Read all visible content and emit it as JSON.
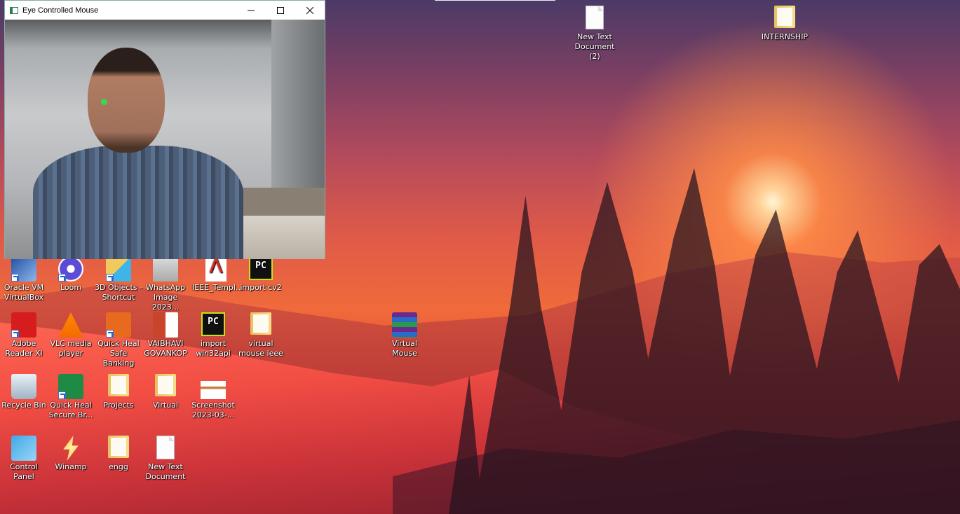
{
  "window": {
    "title": "Eye Controlled Mouse",
    "minimize_icon": "minimize-icon",
    "maximize_icon": "maximize-icon",
    "close_icon": "close-icon"
  },
  "desktop": {
    "top_icons": [
      {
        "label": "New Text Document (2)",
        "icon": "text-file-icon"
      },
      {
        "label": "INTERNSHIP",
        "icon": "folder-icon"
      }
    ],
    "icons": [
      {
        "label": "Oracle VM VirtualBox",
        "icon": "virtualbox-icon"
      },
      {
        "label": "Loom",
        "icon": "loom-icon"
      },
      {
        "label": "3D Objects - Shortcut",
        "icon": "3d-objects-icon"
      },
      {
        "label": "WhatsApp Image 2023...",
        "icon": "image-file-icon"
      },
      {
        "label": "IEEE_Templ...",
        "icon": "pdf-icon"
      },
      {
        "label": "import cv2",
        "icon": "pycharm-icon"
      },
      {
        "label": "Adobe Reader XI",
        "icon": "adobe-reader-icon"
      },
      {
        "label": "VLC media player",
        "icon": "vlc-icon"
      },
      {
        "label": "Quick Heal Safe Banking",
        "icon": "quick-heal-safe-banking-icon"
      },
      {
        "label": "VAIBHAVI GOVANKOP",
        "icon": "powerpoint-icon"
      },
      {
        "label": "import win32api",
        "icon": "pycharm-icon"
      },
      {
        "label": "virtual mouse ieee",
        "icon": "folder-icon"
      },
      {
        "label": "Virtual Mouse",
        "icon": "winrar-icon"
      },
      {
        "label": "Recycle Bin",
        "icon": "recycle-bin-icon"
      },
      {
        "label": "Quick Heal Secure Br...",
        "icon": "quick-heal-browser-icon"
      },
      {
        "label": "Projects",
        "icon": "folder-icon"
      },
      {
        "label": "Virtual",
        "icon": "folder-icon"
      },
      {
        "label": "Screenshot 2023-03-...",
        "icon": "image-file-icon"
      },
      {
        "label": "Control Panel",
        "icon": "control-panel-icon"
      },
      {
        "label": "Winamp",
        "icon": "winamp-icon"
      },
      {
        "label": "engg",
        "icon": "folder-icon"
      },
      {
        "label": "New Text Document",
        "icon": "text-file-icon"
      }
    ]
  },
  "colors": {
    "pycharm_green": "#c6e11c",
    "eye_marker": "#38d84d",
    "pdf_red": "#e1261c"
  }
}
